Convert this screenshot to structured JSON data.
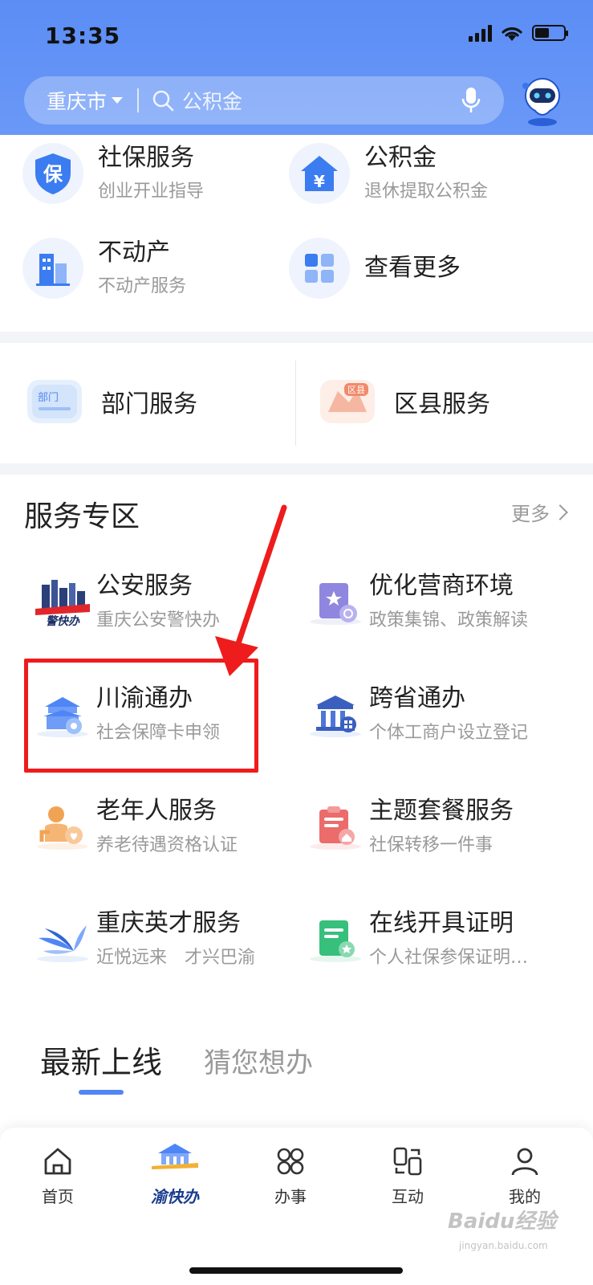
{
  "status": {
    "time": "13:35"
  },
  "search": {
    "city": "重庆市",
    "placeholder": "公积金"
  },
  "top_services": [
    {
      "title": "社保服务",
      "subtitle": "创业开业指导",
      "icon": "shield-bao-icon"
    },
    {
      "title": "公积金",
      "subtitle": "退休提取公积金",
      "icon": "house-yen-icon"
    },
    {
      "title": "不动产",
      "subtitle": "不动产服务",
      "icon": "building-icon"
    },
    {
      "title": "查看更多",
      "subtitle": "",
      "icon": "grid-icon"
    }
  ],
  "dept": [
    {
      "title": "部门服务",
      "badge": "部门"
    },
    {
      "title": "区县服务",
      "badge": "区县"
    }
  ],
  "zone": {
    "title": "服务专区",
    "more": "更多",
    "items": [
      {
        "title": "公安服务",
        "subtitle": "重庆公安警快办",
        "badge": "警快办"
      },
      {
        "title": "优化营商环境",
        "subtitle": "政策集锦、政策解读"
      },
      {
        "title": "川渝通办",
        "subtitle": "社会保障卡申领"
      },
      {
        "title": "跨省通办",
        "subtitle": "个体工商户设立登记"
      },
      {
        "title": "老年人服务",
        "subtitle": "养老待遇资格认证"
      },
      {
        "title": "主题套餐服务",
        "subtitle": "社保转移一件事"
      },
      {
        "title": "重庆英才服务",
        "subtitle": "近悦远来　才兴巴渝"
      },
      {
        "title": "在线开具证明",
        "subtitle": "个人社保参保证明…"
      }
    ]
  },
  "tabs": {
    "active": "最新上线",
    "inactive": "猜您想办"
  },
  "nav": [
    {
      "label": "首页"
    },
    {
      "label": "渝快办"
    },
    {
      "label": "办事"
    },
    {
      "label": "互动"
    },
    {
      "label": "我的"
    }
  ],
  "watermark": {
    "main": "Baidu经验",
    "sub": "jingyan.baidu.com"
  },
  "colors": {
    "header": "#5b8df5",
    "accent": "#4f86f5",
    "highlight": "#ee1c1c"
  }
}
